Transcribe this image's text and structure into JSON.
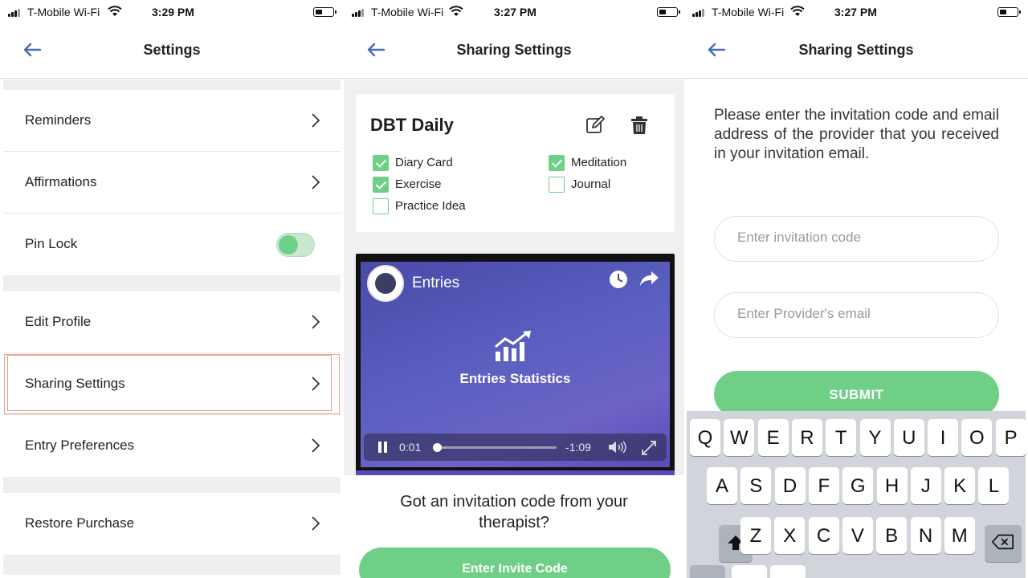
{
  "status_bars": [
    {
      "carrier": "T-Mobile Wi-Fi",
      "time": "3:29 PM"
    },
    {
      "carrier": "T-Mobile Wi-Fi",
      "time": "3:27 PM"
    },
    {
      "carrier": "T-Mobile Wi-Fi",
      "time": "3:27 PM"
    }
  ],
  "settings": {
    "title": "Settings",
    "items": [
      {
        "label": "Reminders"
      },
      {
        "label": "Affirmations"
      },
      {
        "label": "Pin Lock"
      },
      {
        "label": "Edit Profile"
      },
      {
        "label": "Sharing Settings"
      },
      {
        "label": "Entry Preferences"
      },
      {
        "label": "Restore Purchase"
      }
    ],
    "pin_lock_on": true
  },
  "sharing": {
    "title": "Sharing Settings",
    "card": {
      "title": "DBT Daily",
      "checkboxes": [
        {
          "label": "Diary Card",
          "checked": true
        },
        {
          "label": "Meditation",
          "checked": true
        },
        {
          "label": "Exercise",
          "checked": true
        },
        {
          "label": "Journal",
          "checked": false
        },
        {
          "label": "Practice Idea",
          "checked": false
        }
      ]
    },
    "video": {
      "title": "Entries",
      "caption": "Entries Statistics",
      "current_time": "0:01",
      "remaining_time": "-1:09",
      "progress": 0.03
    },
    "invite_question": "Got an invitation code from your therapist?",
    "invite_button": "Enter Invite Code"
  },
  "invite_form": {
    "title": "Sharing Settings",
    "instructions": "Please enter the invitation code and email address of the provider that you received in your invitation email.",
    "code_placeholder": "Enter invitation code",
    "email_placeholder": "Enter Provider's email",
    "submit_label": "SUBMIT"
  },
  "keyboard": {
    "row1": [
      "Q",
      "W",
      "E",
      "R",
      "T",
      "Y",
      "U",
      "I",
      "O",
      "P"
    ],
    "row2": [
      "A",
      "S",
      "D",
      "F",
      "G",
      "H",
      "J",
      "K",
      "L"
    ],
    "row3": [
      "Z",
      "X",
      "C",
      "V",
      "B",
      "N",
      "M"
    ]
  },
  "colors": {
    "accent": "#6fcf87",
    "back_arrow": "#4a6bb5",
    "highlight_border": "#e3a18b"
  }
}
